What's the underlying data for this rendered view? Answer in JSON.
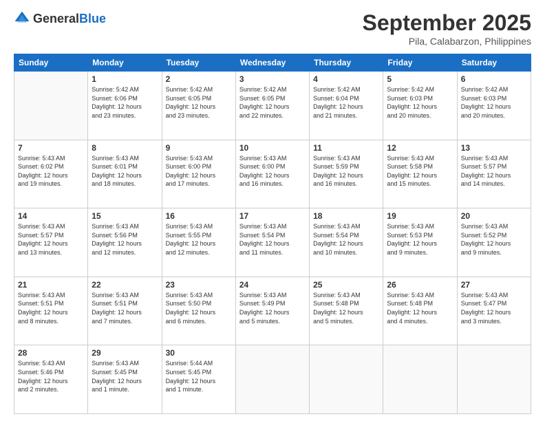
{
  "logo": {
    "general": "General",
    "blue": "Blue"
  },
  "header": {
    "month": "September 2025",
    "location": "Pila, Calabarzon, Philippines"
  },
  "weekdays": [
    "Sunday",
    "Monday",
    "Tuesday",
    "Wednesday",
    "Thursday",
    "Friday",
    "Saturday"
  ],
  "weeks": [
    [
      {
        "day": "",
        "info": ""
      },
      {
        "day": "1",
        "info": "Sunrise: 5:42 AM\nSunset: 6:06 PM\nDaylight: 12 hours\nand 23 minutes."
      },
      {
        "day": "2",
        "info": "Sunrise: 5:42 AM\nSunset: 6:05 PM\nDaylight: 12 hours\nand 23 minutes."
      },
      {
        "day": "3",
        "info": "Sunrise: 5:42 AM\nSunset: 6:05 PM\nDaylight: 12 hours\nand 22 minutes."
      },
      {
        "day": "4",
        "info": "Sunrise: 5:42 AM\nSunset: 6:04 PM\nDaylight: 12 hours\nand 21 minutes."
      },
      {
        "day": "5",
        "info": "Sunrise: 5:42 AM\nSunset: 6:03 PM\nDaylight: 12 hours\nand 20 minutes."
      },
      {
        "day": "6",
        "info": "Sunrise: 5:42 AM\nSunset: 6:03 PM\nDaylight: 12 hours\nand 20 minutes."
      }
    ],
    [
      {
        "day": "7",
        "info": "Sunrise: 5:43 AM\nSunset: 6:02 PM\nDaylight: 12 hours\nand 19 minutes."
      },
      {
        "day": "8",
        "info": "Sunrise: 5:43 AM\nSunset: 6:01 PM\nDaylight: 12 hours\nand 18 minutes."
      },
      {
        "day": "9",
        "info": "Sunrise: 5:43 AM\nSunset: 6:00 PM\nDaylight: 12 hours\nand 17 minutes."
      },
      {
        "day": "10",
        "info": "Sunrise: 5:43 AM\nSunset: 6:00 PM\nDaylight: 12 hours\nand 16 minutes."
      },
      {
        "day": "11",
        "info": "Sunrise: 5:43 AM\nSunset: 5:59 PM\nDaylight: 12 hours\nand 16 minutes."
      },
      {
        "day": "12",
        "info": "Sunrise: 5:43 AM\nSunset: 5:58 PM\nDaylight: 12 hours\nand 15 minutes."
      },
      {
        "day": "13",
        "info": "Sunrise: 5:43 AM\nSunset: 5:57 PM\nDaylight: 12 hours\nand 14 minutes."
      }
    ],
    [
      {
        "day": "14",
        "info": "Sunrise: 5:43 AM\nSunset: 5:57 PM\nDaylight: 12 hours\nand 13 minutes."
      },
      {
        "day": "15",
        "info": "Sunrise: 5:43 AM\nSunset: 5:56 PM\nDaylight: 12 hours\nand 12 minutes."
      },
      {
        "day": "16",
        "info": "Sunrise: 5:43 AM\nSunset: 5:55 PM\nDaylight: 12 hours\nand 12 minutes."
      },
      {
        "day": "17",
        "info": "Sunrise: 5:43 AM\nSunset: 5:54 PM\nDaylight: 12 hours\nand 11 minutes."
      },
      {
        "day": "18",
        "info": "Sunrise: 5:43 AM\nSunset: 5:54 PM\nDaylight: 12 hours\nand 10 minutes."
      },
      {
        "day": "19",
        "info": "Sunrise: 5:43 AM\nSunset: 5:53 PM\nDaylight: 12 hours\nand 9 minutes."
      },
      {
        "day": "20",
        "info": "Sunrise: 5:43 AM\nSunset: 5:52 PM\nDaylight: 12 hours\nand 9 minutes."
      }
    ],
    [
      {
        "day": "21",
        "info": "Sunrise: 5:43 AM\nSunset: 5:51 PM\nDaylight: 12 hours\nand 8 minutes."
      },
      {
        "day": "22",
        "info": "Sunrise: 5:43 AM\nSunset: 5:51 PM\nDaylight: 12 hours\nand 7 minutes."
      },
      {
        "day": "23",
        "info": "Sunrise: 5:43 AM\nSunset: 5:50 PM\nDaylight: 12 hours\nand 6 minutes."
      },
      {
        "day": "24",
        "info": "Sunrise: 5:43 AM\nSunset: 5:49 PM\nDaylight: 12 hours\nand 5 minutes."
      },
      {
        "day": "25",
        "info": "Sunrise: 5:43 AM\nSunset: 5:48 PM\nDaylight: 12 hours\nand 5 minutes."
      },
      {
        "day": "26",
        "info": "Sunrise: 5:43 AM\nSunset: 5:48 PM\nDaylight: 12 hours\nand 4 minutes."
      },
      {
        "day": "27",
        "info": "Sunrise: 5:43 AM\nSunset: 5:47 PM\nDaylight: 12 hours\nand 3 minutes."
      }
    ],
    [
      {
        "day": "28",
        "info": "Sunrise: 5:43 AM\nSunset: 5:46 PM\nDaylight: 12 hours\nand 2 minutes."
      },
      {
        "day": "29",
        "info": "Sunrise: 5:43 AM\nSunset: 5:45 PM\nDaylight: 12 hours\nand 1 minute."
      },
      {
        "day": "30",
        "info": "Sunrise: 5:44 AM\nSunset: 5:45 PM\nDaylight: 12 hours\nand 1 minute."
      },
      {
        "day": "",
        "info": ""
      },
      {
        "day": "",
        "info": ""
      },
      {
        "day": "",
        "info": ""
      },
      {
        "day": "",
        "info": ""
      }
    ]
  ]
}
